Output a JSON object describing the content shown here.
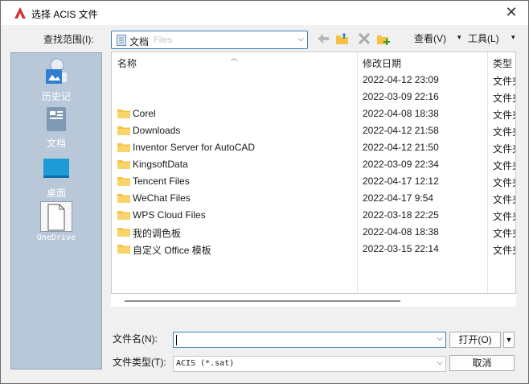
{
  "window": {
    "title": "选择 ACIS 文件",
    "close": "✕"
  },
  "toolbar": {
    "lookin_label": "查找范围(I):",
    "lookin_value": "文档",
    "lookin_ghost": "Files",
    "views_label": "查看(V)",
    "tools_label": "工具(L)"
  },
  "places": [
    {
      "label": "历史记",
      "icon": "history-icon"
    },
    {
      "label": "文档",
      "icon": "documents-icon"
    },
    {
      "label": "桌面",
      "icon": "desktop-icon"
    },
    {
      "label": "OneDrive",
      "icon": "onedrive-icon"
    }
  ],
  "columns": {
    "name": "名称",
    "date": "修改日期",
    "type": "类型"
  },
  "files": [
    {
      "name": "",
      "date": "2022-04-12 23:09",
      "type": "文件夹"
    },
    {
      "name": "",
      "date": "2022-03-09 22:16",
      "type": "文件夹"
    },
    {
      "name": "Corel",
      "date": "2022-04-08 18:38",
      "type": "文件夹"
    },
    {
      "name": "Downloads",
      "date": "2022-04-12 21:58",
      "type": "文件夹"
    },
    {
      "name": "Inventor Server for AutoCAD",
      "date": "2022-04-12 21:50",
      "type": "文件夹"
    },
    {
      "name": "KingsoftData",
      "date": "2022-03-09 22:34",
      "type": "文件夹"
    },
    {
      "name": "Tencent Files",
      "date": "2022-04-17 12:12",
      "type": "文件夹"
    },
    {
      "name": "WeChat Files",
      "date": "2022-04-17 9:54",
      "type": "文件夹"
    },
    {
      "name": "WPS Cloud Files",
      "date": "2022-03-18 22:25",
      "type": "文件夹"
    },
    {
      "name": "我的调色板",
      "date": "2022-04-08 18:38",
      "type": "文件夹"
    },
    {
      "name": "自定义 Office 模板",
      "date": "2022-03-15 22:14",
      "type": "文件夹"
    }
  ],
  "form": {
    "filename_label": "文件名(N):",
    "filename_value": "",
    "filetype_label": "文件类型(T):",
    "filetype_value": "ACIS (*.sat)",
    "open_label": "打开(O)",
    "cancel_label": "取消"
  },
  "colors": {
    "folder": "#f5c242",
    "places_bg": "#b9c8d8",
    "accent": "#3c7fb1",
    "app_red": "#d32f2f"
  }
}
